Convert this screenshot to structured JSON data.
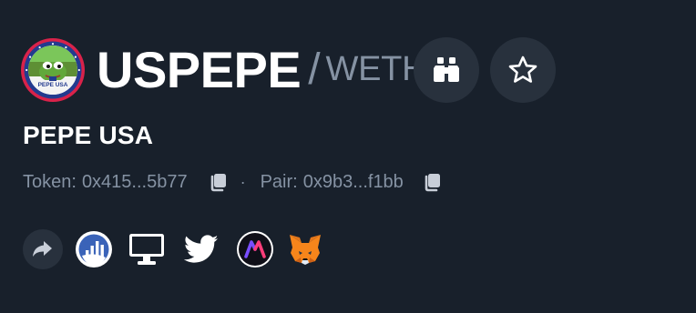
{
  "header": {
    "base_symbol": "USPEPE",
    "separator": "/",
    "quote_symbol": "WETH"
  },
  "logo": {
    "text": "PEPE USA"
  },
  "token": {
    "name": "PEPE USA"
  },
  "addresses": {
    "token_label": "Token:",
    "token_value": "0x415...5b77",
    "separator": "·",
    "pair_label": "Pair:",
    "pair_value": "0x9b3...f1bb"
  },
  "icons": {
    "watchlist": "binoculars-icon",
    "favorite": "star-icon",
    "copy": "copy-icon",
    "links": [
      "share-icon",
      "chart-icon",
      "website-icon",
      "twitter-icon",
      "app-icon",
      "metamask-icon"
    ]
  },
  "colors": {
    "background": "#18202b",
    "button_bg": "#28313d",
    "muted_text": "#8592a3",
    "primary_text": "#ffffff"
  }
}
